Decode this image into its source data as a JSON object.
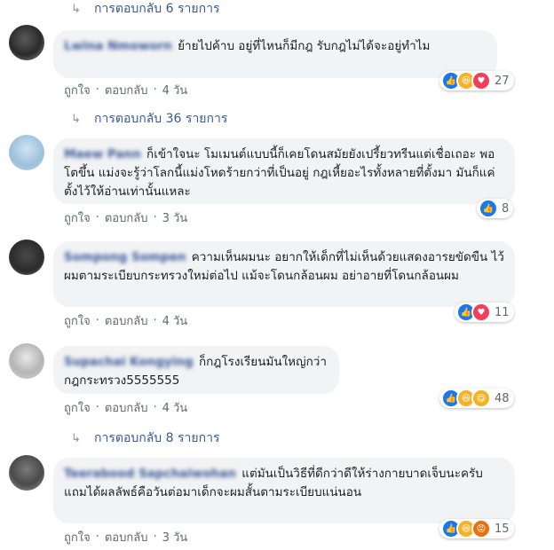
{
  "replies_prefix": "การตอบกลับ",
  "replies_suffix": "รายการ",
  "actions": {
    "like": "ถูกใจ",
    "reply": "ตอบกลับ",
    "dot": "·"
  },
  "comments": [
    {
      "replies_before": "6",
      "name": "Lwina Nmoworn",
      "text": "ย้ายไปค้าบ อยู่ที่ไหนก็มีกฎ รับกฎไม่ได้จะอยู่ทำไม",
      "time": "4 วัน",
      "reactions": [
        "like",
        "haha",
        "love"
      ],
      "count": "27",
      "replies_after": "36"
    },
    {
      "name": "Maew Pann",
      "text": "ก็เข้าใจนะ โมเมนต์แบบนี้ก็เคยโดนสมัยยังเปรี้ยวทรีนแต่เชื่อเถอะ พอโตขึ้น แม่งจะรู้ว่าโลกนี้แม่งโหดร้ายกว่าที่เป็นอยู่ กฎเหี้ยอะไรทั้งหลายที่ตั้งมา มันก็แค่ตั้งไว้ให้อ่านเท่านั้นแหละ",
      "time": "3 วัน",
      "reactions": [
        "like"
      ],
      "count": "8"
    },
    {
      "name": "Sompong Sompen",
      "text": "ความเห็นผมนะ อยากให้เด็กที่ไม่เห็นด้วยแสดงอารยขัดขืน ไว้ผมตามระเบียบกระทรวงใหม่ต่อไป แม้จะโดนกล้อนผม อย่าอายที่โดนกล้อนผม",
      "time": "4 วัน",
      "reactions": [
        "like",
        "love"
      ],
      "count": "11"
    },
    {
      "name": "Supachai Kongying",
      "text": "ก็กฎโรงเรียนมันใหญ่กว่ากฎกระทรวง5555555",
      "time": "4 วัน",
      "reactions": [
        "like",
        "haha",
        "haha"
      ],
      "count": "48",
      "replies_after": "8"
    },
    {
      "name": "Teerabood Sapchaiwohan",
      "text": "แต่มันเป็นวิธีที่ดีกว่าดีให้ร่างกายบาดเจ็บนะครับ แถมได้ผลลัพธ์คือวันต่อมาเด็กจะผมสั้นตามระเบียบแน่นอน",
      "time": "3 วัน",
      "reactions": [
        "like",
        "haha",
        "angry"
      ],
      "count": "15"
    }
  ],
  "icons": {
    "reply_arrow": "reply-arrow-icon",
    "like": "like-reaction-icon",
    "haha": "haha-reaction-icon",
    "love": "love-reaction-icon",
    "angry": "angry-reaction-icon"
  }
}
